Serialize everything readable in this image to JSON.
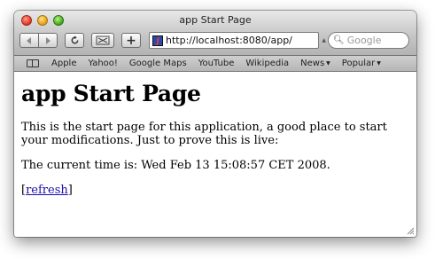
{
  "window": {
    "title": "app Start Page"
  },
  "toolbar": {
    "back_icon": "back-arrow-icon",
    "forward_icon": "forward-arrow-icon",
    "reload_icon": "reload-icon",
    "snapback_icon": "snapback-icon",
    "add_bookmark_label": "+",
    "url": "http://localhost:8080/app/",
    "search_placeholder": "Google"
  },
  "bookmarks": {
    "items": [
      {
        "label": "Apple"
      },
      {
        "label": "Yahoo!"
      },
      {
        "label": "Google Maps"
      },
      {
        "label": "YouTube"
      },
      {
        "label": "Wikipedia"
      },
      {
        "label": "News",
        "dropdown": true
      },
      {
        "label": "Popular",
        "dropdown": true
      }
    ]
  },
  "page": {
    "heading": "app Start Page",
    "intro": "This is the start page for this application, a good place to start your modifications. Just to prove this is live:",
    "time_text": "The current time is: Wed Feb 13 15:08:57 CET 2008.",
    "refresh_open": "[",
    "refresh_label": "refresh",
    "refresh_close": "]"
  }
}
